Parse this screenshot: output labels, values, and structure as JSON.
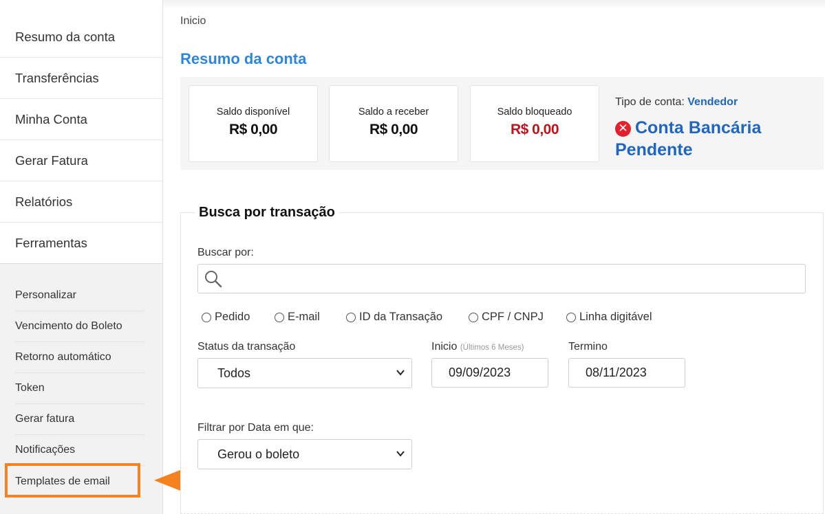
{
  "sidebar": {
    "main_items": [
      {
        "label": "Resumo da conta"
      },
      {
        "label": "Transferências"
      },
      {
        "label": "Minha Conta"
      },
      {
        "label": "Gerar Fatura"
      },
      {
        "label": "Relatórios"
      },
      {
        "label": "Ferramentas"
      }
    ],
    "sub_items": [
      {
        "label": "Personalizar"
      },
      {
        "label": "Vencimento do Boleto"
      },
      {
        "label": "Retorno automático"
      },
      {
        "label": "Token"
      },
      {
        "label": "Gerar fatura"
      },
      {
        "label": "Notificações"
      },
      {
        "label": "Templates de email"
      }
    ],
    "highlighted_item": "Templates de email"
  },
  "breadcrumb": "Inicio",
  "page_title": "Resumo da conta",
  "summary": {
    "cards": [
      {
        "label": "Saldo disponível",
        "value": "R$ 0,00"
      },
      {
        "label": "Saldo a receber",
        "value": "R$ 0,00"
      },
      {
        "label": "Saldo bloqueado",
        "value": "R$ 0,00"
      }
    ],
    "account_type_label": "Tipo de conta:",
    "account_type_value": "Vendedor",
    "bank_status_icon": "x-circle-icon",
    "bank_status": "Conta Bancária Pendente"
  },
  "search": {
    "legend": "Busca por transação",
    "search_by_label": "Buscar por:",
    "search_value": "",
    "options": [
      {
        "label": "Pedido"
      },
      {
        "label": "E-mail"
      },
      {
        "label": "ID da Transação"
      },
      {
        "label": "CPF / CNPJ"
      },
      {
        "label": "Linha digitável"
      }
    ],
    "status_label": "Status da transação",
    "status_value": "Todos",
    "start_label": "Inicio",
    "start_hint": "(Últimos 6 Meses)",
    "start_value": "09/09/2023",
    "end_label": "Termino",
    "end_value": "08/11/2023",
    "filter_label": "Filtrar por Data em que:",
    "filter_value": "Gerou o boleto"
  },
  "colors": {
    "accent": "#2b86e0",
    "account_blue": "#1f66c1",
    "negative_red": "#c0121a",
    "highlight_orange": "#f5821f",
    "error_red": "#e3202b"
  }
}
